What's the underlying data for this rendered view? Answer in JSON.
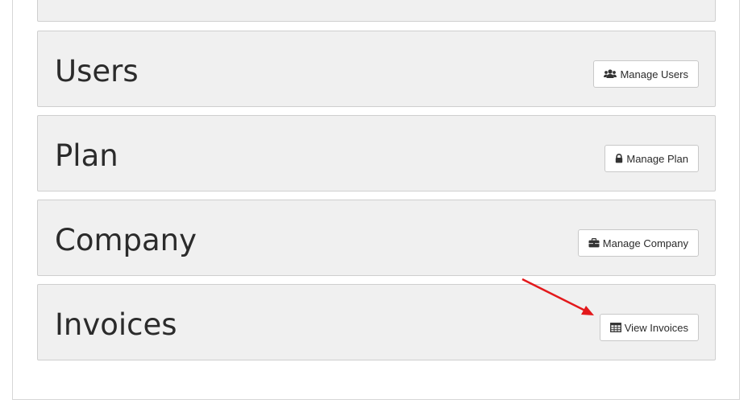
{
  "cards": [
    {
      "title": "Users",
      "button": "Manage Users",
      "icon": "users-icon"
    },
    {
      "title": "Plan",
      "button": "Manage Plan",
      "icon": "lock-icon"
    },
    {
      "title": "Company",
      "button": "Manage Company",
      "icon": "briefcase-icon"
    },
    {
      "title": "Invoices",
      "button": "View Invoices",
      "icon": "table-icon"
    }
  ],
  "annotation": {
    "color": "#e3191c",
    "icon": "red-arrow-icon"
  }
}
